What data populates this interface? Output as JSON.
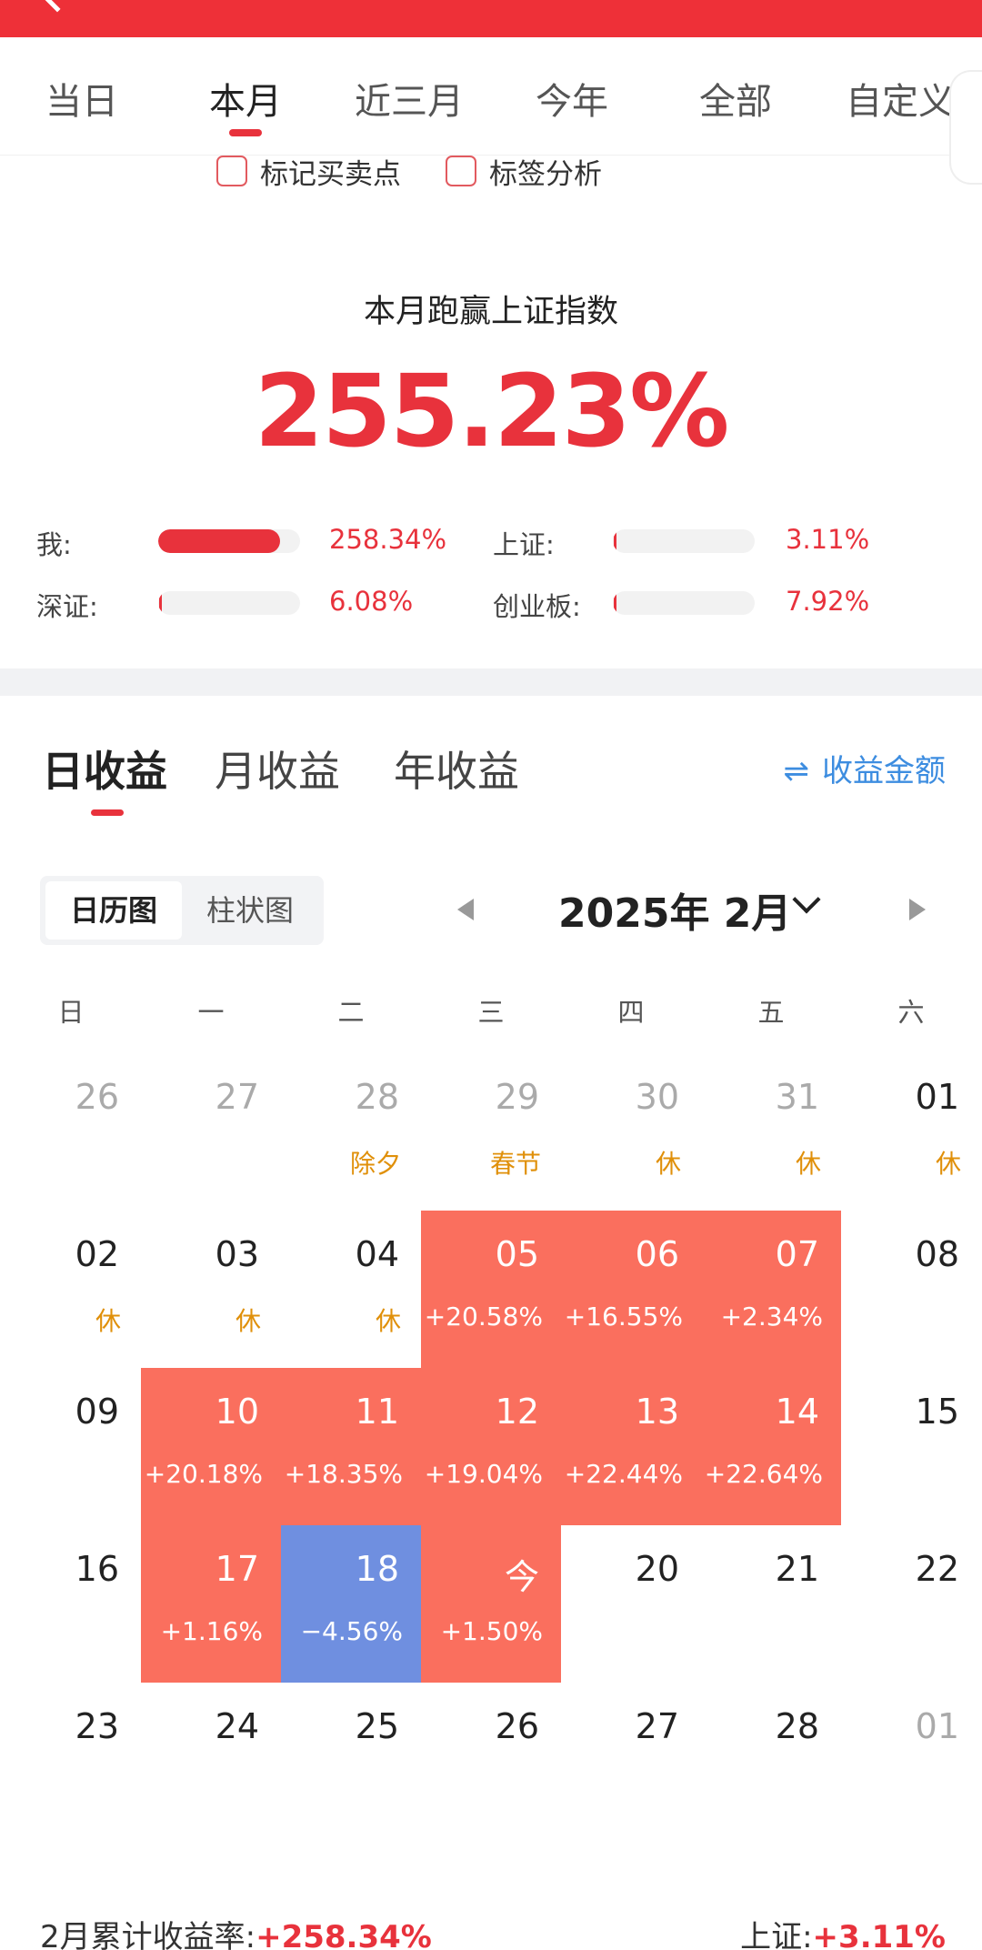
{
  "period_tabs": [
    "当日",
    "本月",
    "近三月",
    "今年",
    "全部",
    "自定义"
  ],
  "period_active": "本月",
  "checks": {
    "mark_trades": "标记买卖点",
    "tag_analysis": "标签分析"
  },
  "beat": {
    "title": "本月跑赢上证指数",
    "value": "255.23%"
  },
  "compare": [
    {
      "label": "我:",
      "value": "258.34%",
      "level_pct": 258.34
    },
    {
      "label": "上证:",
      "value": "3.11%",
      "level_pct": 3.11
    },
    {
      "label": "深证:",
      "value": "6.08%",
      "level_pct": 6.08
    },
    {
      "label": "创业板:",
      "value": "7.92%",
      "level_pct": 7.92
    }
  ],
  "earn_tabs": [
    "日收益",
    "月收益",
    "年收益"
  ],
  "earn_active": "日收益",
  "amount_toggle": {
    "icon": "swap-arrows-icon",
    "arrows": "⇌",
    "label": "收益金额"
  },
  "view_switch": [
    "日历图",
    "柱状图"
  ],
  "view_active": "日历图",
  "month_label": "2025年 2月",
  "weekdays": [
    "日",
    "一",
    "二",
    "三",
    "四",
    "五",
    "六"
  ],
  "calendar": [
    [
      {
        "num": "26",
        "sub": "",
        "type": "other"
      },
      {
        "num": "27",
        "sub": "",
        "type": "other"
      },
      {
        "num": "28",
        "sub": "除夕",
        "type": "other"
      },
      {
        "num": "29",
        "sub": "春节",
        "type": "other"
      },
      {
        "num": "30",
        "sub": "休",
        "type": "other"
      },
      {
        "num": "31",
        "sub": "休",
        "type": "other"
      },
      {
        "num": "01",
        "sub": "休",
        "type": "plain"
      }
    ],
    [
      {
        "num": "02",
        "sub": "休",
        "type": "plain"
      },
      {
        "num": "03",
        "sub": "休",
        "type": "plain"
      },
      {
        "num": "04",
        "sub": "休",
        "type": "plain"
      },
      {
        "num": "05",
        "sub": "+20.58%",
        "type": "up"
      },
      {
        "num": "06",
        "sub": "+16.55%",
        "type": "up"
      },
      {
        "num": "07",
        "sub": "+2.34%",
        "type": "up"
      },
      {
        "num": "08",
        "sub": "",
        "type": "plain"
      }
    ],
    [
      {
        "num": "09",
        "sub": "",
        "type": "plain"
      },
      {
        "num": "10",
        "sub": "+20.18%",
        "type": "up"
      },
      {
        "num": "11",
        "sub": "+18.35%",
        "type": "up"
      },
      {
        "num": "12",
        "sub": "+19.04%",
        "type": "up"
      },
      {
        "num": "13",
        "sub": "+22.44%",
        "type": "up"
      },
      {
        "num": "14",
        "sub": "+22.64%",
        "type": "up"
      },
      {
        "num": "15",
        "sub": "",
        "type": "plain"
      }
    ],
    [
      {
        "num": "16",
        "sub": "",
        "type": "plain"
      },
      {
        "num": "17",
        "sub": "+1.16%",
        "type": "up"
      },
      {
        "num": "18",
        "sub": "−4.56%",
        "type": "down"
      },
      {
        "num": "今",
        "sub": "+1.50%",
        "type": "up"
      },
      {
        "num": "20",
        "sub": "",
        "type": "plain"
      },
      {
        "num": "21",
        "sub": "",
        "type": "plain"
      },
      {
        "num": "22",
        "sub": "",
        "type": "plain"
      }
    ],
    [
      {
        "num": "23",
        "sub": "",
        "type": "plain"
      },
      {
        "num": "24",
        "sub": "",
        "type": "plain"
      },
      {
        "num": "25",
        "sub": "",
        "type": "plain"
      },
      {
        "num": "26",
        "sub": "",
        "type": "plain"
      },
      {
        "num": "27",
        "sub": "",
        "type": "plain"
      },
      {
        "num": "28",
        "sub": "",
        "type": "plain"
      },
      {
        "num": "01",
        "sub": "",
        "type": "other"
      }
    ]
  ],
  "summary": {
    "left_label": "2月累计收益率:",
    "left_value": "+258.34%",
    "right_label": "上证:",
    "right_value": "+3.11%"
  },
  "colors": {
    "accent_red": "#e8323c",
    "gain_cell": "#fa6f5e",
    "loss_cell": "#6f8fe0",
    "holiday_text": "#e0900a",
    "link_blue": "#3d8de0"
  }
}
